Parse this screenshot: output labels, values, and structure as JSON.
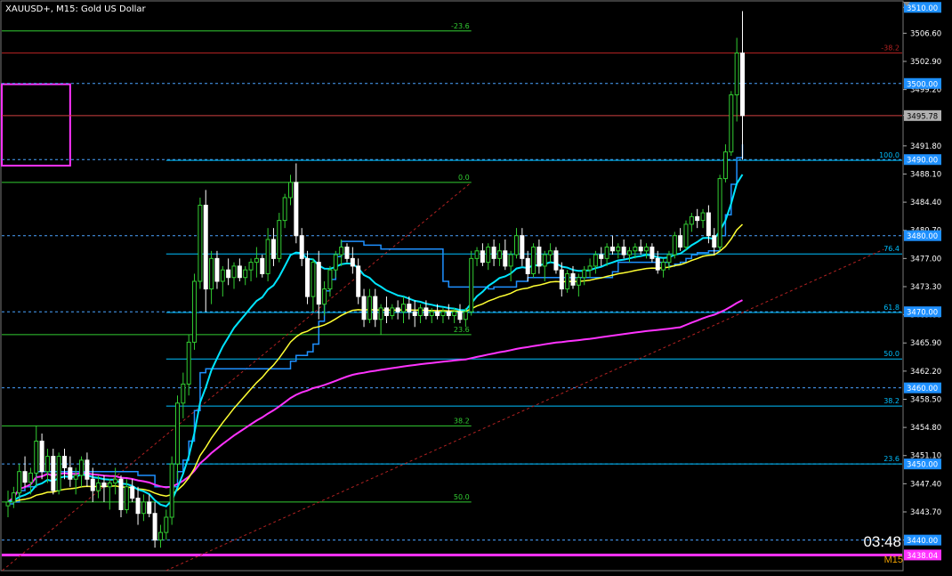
{
  "header": {
    "title": "XAUUSD+, M15:  Gold US Dollar"
  },
  "timer": "03:48",
  "timeframe": "M15",
  "colors": {
    "background": "#000000",
    "bull": "#32cd32",
    "bear": "#ffffff",
    "fib_green": "#32cd32",
    "fib_cyan": "#00bfff",
    "fib_red": "#b22222",
    "level_dashed": "#4aa3ff",
    "ma_cyan": "#00e5ff",
    "ma_blue": "#1e90ff",
    "ma_yellow": "#ffff33",
    "ma_magenta": "#ff33ff",
    "ma_red": "#b22222",
    "current_price": "#d04040",
    "rectangle": "#ff33ff"
  },
  "chart_data": {
    "type": "candlestick",
    "ylim": [
      3437.5,
      3510.5
    ],
    "y_ticks": [
      "3510.00",
      "3506.60",
      "3502.90",
      "3499.20",
      "3495.80",
      "3491.80",
      "3488.10",
      "3484.40",
      "3480.70",
      "3477.00",
      "3473.30",
      "3469.60",
      "3465.90",
      "3462.20",
      "3458.50",
      "3454.80",
      "3451.10",
      "3447.40",
      "3443.70",
      "3440.00"
    ],
    "price_tags": [
      {
        "label": "3510.00",
        "value": 3510.0,
        "style": "cyan"
      },
      {
        "label": "3500.00",
        "value": 3500.0,
        "style": "cyan"
      },
      {
        "label": "3495.78",
        "value": 3495.78,
        "style": "current"
      },
      {
        "label": "3490.00",
        "value": 3490.0,
        "style": "cyan"
      },
      {
        "label": "3480.00",
        "value": 3480.0,
        "style": "cyan"
      },
      {
        "label": "3470.00",
        "value": 3470.0,
        "style": "cyan"
      },
      {
        "label": "3460.00",
        "value": 3460.0,
        "style": "cyan"
      },
      {
        "label": "3450.00",
        "value": 3450.0,
        "style": "cyan"
      },
      {
        "label": "3440.00",
        "value": 3440.0,
        "style": "cyan"
      },
      {
        "label": "3438.04",
        "value": 3438.04,
        "style": "magenta"
      }
    ],
    "dashed_levels": [
      3500.0,
      3490.0,
      3480.0,
      3470.0,
      3460.0,
      3450.0,
      3440.0
    ],
    "current_price": 3495.78,
    "magenta_level": 3438.04,
    "fib_green": {
      "x_start": 0,
      "x_end": 82,
      "levels": [
        {
          "label": "-23.6",
          "value": 3506.9
        },
        {
          "label": "0.0",
          "value": 3487.0
        },
        {
          "label": "23.6",
          "value": 3467.0
        },
        {
          "label": "38.2",
          "value": 3455.0
        },
        {
          "label": "50.0",
          "value": 3445.0
        }
      ]
    },
    "fib_cyan": {
      "x_start": 28,
      "x_end": 155,
      "levels": [
        {
          "label": "100.0",
          "value": 3489.9
        },
        {
          "label": "76.4",
          "value": 3477.6
        },
        {
          "label": "61.8",
          "value": 3469.9
        },
        {
          "label": "50.0",
          "value": 3463.8
        },
        {
          "label": "38.2",
          "value": 3457.6
        },
        {
          "label": "23.6",
          "value": 3450.0
        }
      ]
    },
    "fib_red": {
      "label": "-38.2",
      "value": 3504.0
    },
    "rectangle": {
      "x1": 0,
      "x2": 11,
      "high": 3499.9,
      "low": 3489.2
    },
    "trend_lines": [
      {
        "from": [
          -1,
          3436.0
        ],
        "to": [
          82,
          3487.0
        ]
      },
      {
        "from": [
          28,
          3436.0
        ],
        "to": [
          155,
          3478.2
        ]
      }
    ],
    "ohlc": [
      [
        3444.5,
        3446.5,
        3443.0,
        3445.0
      ],
      [
        3445.0,
        3447.0,
        3444.2,
        3446.2
      ],
      [
        3446.2,
        3450.0,
        3445.5,
        3449.0
      ],
      [
        3449.0,
        3451.0,
        3447.0,
        3447.6
      ],
      [
        3447.6,
        3449.5,
        3446.0,
        3448.8
      ],
      [
        3448.8,
        3455.0,
        3447.0,
        3453.0
      ],
      [
        3453.0,
        3454.0,
        3448.0,
        3449.0
      ],
      [
        3449.0,
        3452.0,
        3447.5,
        3451.0
      ],
      [
        3451.0,
        3452.0,
        3446.0,
        3446.5
      ],
      [
        3446.5,
        3451.5,
        3446.0,
        3451.0
      ],
      [
        3451.0,
        3452.0,
        3448.0,
        3449.5
      ],
      [
        3449.5,
        3451.0,
        3447.0,
        3448.0
      ],
      [
        3448.0,
        3449.5,
        3446.0,
        3448.5
      ],
      [
        3448.5,
        3451.0,
        3447.0,
        3450.5
      ],
      [
        3450.5,
        3451.5,
        3447.0,
        3448.0
      ],
      [
        3448.0,
        3449.5,
        3445.0,
        3446.5
      ],
      [
        3446.5,
        3448.5,
        3445.5,
        3447.5
      ],
      [
        3447.5,
        3448.5,
        3445.0,
        3447.0
      ],
      [
        3447.0,
        3448.0,
        3444.0,
        3447.5
      ],
      [
        3447.5,
        3449.5,
        3446.0,
        3448.0
      ],
      [
        3448.0,
        3448.5,
        3443.0,
        3444.0
      ],
      [
        3444.0,
        3448.0,
        3443.5,
        3447.0
      ],
      [
        3447.0,
        3448.0,
        3445.0,
        3445.5
      ],
      [
        3445.5,
        3447.0,
        3442.0,
        3443.5
      ],
      [
        3443.5,
        3446.0,
        3442.5,
        3445.0
      ],
      [
        3445.0,
        3446.0,
        3443.0,
        3443.5
      ],
      [
        3443.5,
        3445.0,
        3439.0,
        3440.0
      ],
      [
        3440.0,
        3442.0,
        3439.0,
        3441.0
      ],
      [
        3441.0,
        3444.0,
        3440.0,
        3443.0
      ],
      [
        3443.0,
        3451.0,
        3442.0,
        3450.0
      ],
      [
        3450.0,
        3459.0,
        3448.0,
        3458.0
      ],
      [
        3458.0,
        3462.0,
        3456.0,
        3460.5
      ],
      [
        3460.5,
        3467.0,
        3459.0,
        3466.0
      ],
      [
        3466.0,
        3475.0,
        3465.0,
        3474.0
      ],
      [
        3474.0,
        3485.0,
        3473.0,
        3484.0
      ],
      [
        3484.0,
        3486.0,
        3470.0,
        3473.0
      ],
      [
        3473.0,
        3478.0,
        3471.0,
        3477.0
      ],
      [
        3477.0,
        3478.0,
        3473.0,
        3474.0
      ],
      [
        3474.0,
        3476.0,
        3472.0,
        3475.5
      ],
      [
        3475.5,
        3477.0,
        3473.5,
        3474.5
      ],
      [
        3474.5,
        3476.5,
        3473.0,
        3476.0
      ],
      [
        3476.0,
        3477.0,
        3474.0,
        3474.5
      ],
      [
        3474.5,
        3476.0,
        3473.5,
        3475.5
      ],
      [
        3475.5,
        3477.0,
        3474.0,
        3476.5
      ],
      [
        3476.5,
        3478.5,
        3474.5,
        3477.0
      ],
      [
        3477.0,
        3477.5,
        3474.5,
        3475.0
      ],
      [
        3475.0,
        3481.0,
        3474.0,
        3479.5
      ],
      [
        3479.5,
        3481.0,
        3476.0,
        3477.0
      ],
      [
        3477.0,
        3483.0,
        3476.5,
        3482.0
      ],
      [
        3482.0,
        3485.5,
        3481.0,
        3485.0
      ],
      [
        3485.0,
        3488.0,
        3484.0,
        3487.0
      ],
      [
        3487.0,
        3489.5,
        3479.0,
        3480.0
      ],
      [
        3480.0,
        3481.0,
        3476.0,
        3477.0
      ],
      [
        3477.0,
        3478.0,
        3471.0,
        3472.0
      ],
      [
        3472.0,
        3477.0,
        3470.0,
        3476.5
      ],
      [
        3476.5,
        3478.0,
        3469.0,
        3471.0
      ],
      [
        3471.0,
        3474.0,
        3469.5,
        3473.0
      ],
      [
        3473.0,
        3476.0,
        3472.0,
        3475.5
      ],
      [
        3475.5,
        3478.0,
        3474.5,
        3477.5
      ],
      [
        3477.5,
        3479.5,
        3476.0,
        3478.5
      ],
      [
        3478.5,
        3479.0,
        3476.5,
        3477.0
      ],
      [
        3477.0,
        3478.5,
        3475.0,
        3476.0
      ],
      [
        3476.0,
        3477.0,
        3471.0,
        3472.0
      ],
      [
        3472.0,
        3473.0,
        3468.0,
        3469.0
      ],
      [
        3469.0,
        3473.0,
        3468.5,
        3472.0
      ],
      [
        3472.0,
        3473.0,
        3468.0,
        3469.0
      ],
      [
        3469.0,
        3471.0,
        3467.0,
        3470.5
      ],
      [
        3470.5,
        3472.0,
        3468.5,
        3469.5
      ],
      [
        3469.5,
        3471.0,
        3469.0,
        3470.5
      ],
      [
        3470.5,
        3471.5,
        3469.0,
        3470.0
      ],
      [
        3470.0,
        3472.0,
        3468.5,
        3471.0
      ],
      [
        3471.0,
        3472.0,
        3469.0,
        3470.0
      ],
      [
        3470.0,
        3471.5,
        3468.0,
        3469.5
      ],
      [
        3469.5,
        3471.0,
        3468.5,
        3470.5
      ],
      [
        3470.5,
        3471.5,
        3469.0,
        3469.5
      ],
      [
        3469.5,
        3470.5,
        3468.5,
        3470.0
      ],
      [
        3470.0,
        3471.0,
        3469.0,
        3469.5
      ],
      [
        3469.5,
        3470.5,
        3468.5,
        3470.0
      ],
      [
        3470.0,
        3471.0,
        3469.0,
        3469.5
      ],
      [
        3469.5,
        3470.5,
        3468.5,
        3470.0
      ],
      [
        3470.0,
        3471.0,
        3468.5,
        3469.0
      ],
      [
        3469.0,
        3470.5,
        3468.0,
        3470.0
      ],
      [
        3470.0,
        3478.0,
        3469.5,
        3477.0
      ],
      [
        3477.0,
        3478.5,
        3476.0,
        3478.0
      ],
      [
        3478.0,
        3479.0,
        3476.0,
        3476.5
      ],
      [
        3476.5,
        3479.0,
        3475.5,
        3478.5
      ],
      [
        3478.5,
        3479.5,
        3476.0,
        3477.0
      ],
      [
        3477.0,
        3479.0,
        3476.0,
        3478.0
      ],
      [
        3478.0,
        3479.5,
        3475.5,
        3476.0
      ],
      [
        3476.0,
        3478.0,
        3474.0,
        3477.5
      ],
      [
        3477.5,
        3481.0,
        3477.0,
        3480.0
      ],
      [
        3480.0,
        3481.0,
        3476.0,
        3477.0
      ],
      [
        3477.0,
        3478.0,
        3474.0,
        3475.0
      ],
      [
        3475.0,
        3479.0,
        3474.5,
        3478.5
      ],
      [
        3478.5,
        3479.5,
        3475.0,
        3476.0
      ],
      [
        3476.0,
        3478.0,
        3474.0,
        3477.5
      ],
      [
        3477.5,
        3479.0,
        3476.5,
        3478.0
      ],
      [
        3478.0,
        3478.5,
        3475.0,
        3475.5
      ],
      [
        3475.5,
        3476.5,
        3472.0,
        3473.0
      ],
      [
        3473.0,
        3475.5,
        3472.5,
        3475.0
      ],
      [
        3475.0,
        3476.0,
        3473.0,
        3473.5
      ],
      [
        3473.5,
        3475.0,
        3472.0,
        3474.5
      ],
      [
        3474.5,
        3476.0,
        3473.5,
        3475.5
      ],
      [
        3475.5,
        3477.0,
        3474.5,
        3476.0
      ],
      [
        3476.0,
        3478.0,
        3475.0,
        3477.5
      ],
      [
        3477.5,
        3478.5,
        3476.0,
        3477.0
      ],
      [
        3477.0,
        3479.0,
        3476.0,
        3478.5
      ],
      [
        3478.5,
        3480.0,
        3477.5,
        3478.0
      ],
      [
        3478.0,
        3479.0,
        3477.0,
        3478.5
      ],
      [
        3478.5,
        3479.5,
        3477.0,
        3477.5
      ],
      [
        3477.5,
        3478.5,
        3476.5,
        3478.0
      ],
      [
        3478.0,
        3479.0,
        3477.0,
        3478.5
      ],
      [
        3478.5,
        3479.5,
        3477.5,
        3478.0
      ],
      [
        3478.0,
        3479.0,
        3477.0,
        3478.5
      ],
      [
        3478.5,
        3479.0,
        3476.5,
        3477.0
      ],
      [
        3477.0,
        3478.0,
        3475.0,
        3475.5
      ],
      [
        3475.5,
        3477.0,
        3474.5,
        3476.5
      ],
      [
        3476.5,
        3478.0,
        3475.5,
        3477.5
      ],
      [
        3477.5,
        3480.5,
        3477.0,
        3480.0
      ],
      [
        3480.0,
        3481.0,
        3478.0,
        3478.5
      ],
      [
        3478.5,
        3482.0,
        3478.0,
        3481.5
      ],
      [
        3481.5,
        3483.0,
        3480.5,
        3482.5
      ],
      [
        3482.5,
        3483.5,
        3481.0,
        3482.0
      ],
      [
        3482.0,
        3483.5,
        3481.0,
        3483.0
      ],
      [
        3483.0,
        3484.0,
        3479.0,
        3480.0
      ],
      [
        3480.0,
        3481.0,
        3477.5,
        3478.5
      ],
      [
        3478.5,
        3488.0,
        3478.0,
        3487.5
      ],
      [
        3487.5,
        3492.0,
        3487.0,
        3491.0
      ],
      [
        3491.0,
        3499.0,
        3490.5,
        3498.5
      ],
      [
        3498.5,
        3506.0,
        3495.0,
        3504.0
      ],
      [
        3504.0,
        3509.5,
        3490.0,
        3495.78
      ]
    ]
  }
}
